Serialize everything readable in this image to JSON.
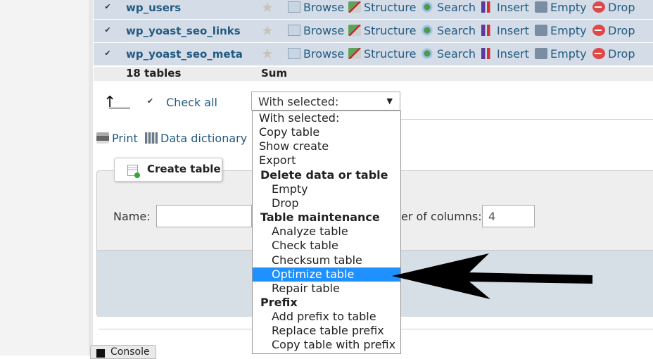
{
  "tables": [
    {
      "name": "wp_users",
      "checked": true
    },
    {
      "name": "wp_yoast_seo_links",
      "checked": true
    },
    {
      "name": "wp_yoast_seo_meta",
      "checked": true
    }
  ],
  "actions": {
    "browse": "Browse",
    "structure": "Structure",
    "search": "Search",
    "insert": "Insert",
    "empty": "Empty",
    "drop": "Drop"
  },
  "summary": {
    "count_label": "18 tables",
    "sum_label": "Sum"
  },
  "bulk": {
    "check_all": "Check all",
    "select_value": "With selected:",
    "options": [
      {
        "label": "With selected:",
        "type": "option"
      },
      {
        "label": "Copy table",
        "type": "option"
      },
      {
        "label": "Show create",
        "type": "option"
      },
      {
        "label": "Export",
        "type": "option"
      },
      {
        "label": "Delete data or table",
        "type": "group"
      },
      {
        "label": "Empty",
        "type": "sub"
      },
      {
        "label": "Drop",
        "type": "sub"
      },
      {
        "label": "Table maintenance",
        "type": "group"
      },
      {
        "label": "Analyze table",
        "type": "sub"
      },
      {
        "label": "Check table",
        "type": "sub"
      },
      {
        "label": "Checksum table",
        "type": "sub"
      },
      {
        "label": "Optimize table",
        "type": "sub",
        "highlighted": true
      },
      {
        "label": "Repair table",
        "type": "sub"
      },
      {
        "label": "Prefix",
        "type": "group"
      },
      {
        "label": "Add prefix to table",
        "type": "sub"
      },
      {
        "label": "Replace table prefix",
        "type": "sub"
      },
      {
        "label": "Copy table with prefix",
        "type": "sub"
      }
    ]
  },
  "links": {
    "print": "Print",
    "data_dictionary": "Data dictionary"
  },
  "create_table": {
    "legend": "Create table",
    "name_label": "Name:",
    "columns_label": "er of columns:",
    "columns_value": "4"
  },
  "console": {
    "label": "Console"
  },
  "colors": {
    "row_bg": "#d4dde7",
    "link": "#235a81",
    "highlight": "#1e90ff"
  }
}
